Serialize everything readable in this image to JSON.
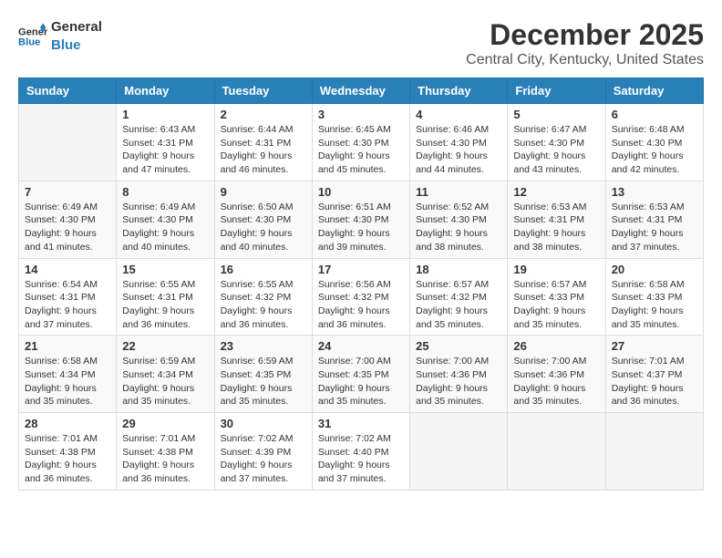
{
  "header": {
    "logo_line1": "General",
    "logo_line2": "Blue",
    "month_title": "December 2025",
    "location": "Central City, Kentucky, United States"
  },
  "weekdays": [
    "Sunday",
    "Monday",
    "Tuesday",
    "Wednesday",
    "Thursday",
    "Friday",
    "Saturday"
  ],
  "weeks": [
    [
      {
        "day": "",
        "info": ""
      },
      {
        "day": "1",
        "info": "Sunrise: 6:43 AM\nSunset: 4:31 PM\nDaylight: 9 hours\nand 47 minutes."
      },
      {
        "day": "2",
        "info": "Sunrise: 6:44 AM\nSunset: 4:31 PM\nDaylight: 9 hours\nand 46 minutes."
      },
      {
        "day": "3",
        "info": "Sunrise: 6:45 AM\nSunset: 4:30 PM\nDaylight: 9 hours\nand 45 minutes."
      },
      {
        "day": "4",
        "info": "Sunrise: 6:46 AM\nSunset: 4:30 PM\nDaylight: 9 hours\nand 44 minutes."
      },
      {
        "day": "5",
        "info": "Sunrise: 6:47 AM\nSunset: 4:30 PM\nDaylight: 9 hours\nand 43 minutes."
      },
      {
        "day": "6",
        "info": "Sunrise: 6:48 AM\nSunset: 4:30 PM\nDaylight: 9 hours\nand 42 minutes."
      }
    ],
    [
      {
        "day": "7",
        "info": "Sunrise: 6:49 AM\nSunset: 4:30 PM\nDaylight: 9 hours\nand 41 minutes."
      },
      {
        "day": "8",
        "info": "Sunrise: 6:49 AM\nSunset: 4:30 PM\nDaylight: 9 hours\nand 40 minutes."
      },
      {
        "day": "9",
        "info": "Sunrise: 6:50 AM\nSunset: 4:30 PM\nDaylight: 9 hours\nand 40 minutes."
      },
      {
        "day": "10",
        "info": "Sunrise: 6:51 AM\nSunset: 4:30 PM\nDaylight: 9 hours\nand 39 minutes."
      },
      {
        "day": "11",
        "info": "Sunrise: 6:52 AM\nSunset: 4:30 PM\nDaylight: 9 hours\nand 38 minutes."
      },
      {
        "day": "12",
        "info": "Sunrise: 6:53 AM\nSunset: 4:31 PM\nDaylight: 9 hours\nand 38 minutes."
      },
      {
        "day": "13",
        "info": "Sunrise: 6:53 AM\nSunset: 4:31 PM\nDaylight: 9 hours\nand 37 minutes."
      }
    ],
    [
      {
        "day": "14",
        "info": "Sunrise: 6:54 AM\nSunset: 4:31 PM\nDaylight: 9 hours\nand 37 minutes."
      },
      {
        "day": "15",
        "info": "Sunrise: 6:55 AM\nSunset: 4:31 PM\nDaylight: 9 hours\nand 36 minutes."
      },
      {
        "day": "16",
        "info": "Sunrise: 6:55 AM\nSunset: 4:32 PM\nDaylight: 9 hours\nand 36 minutes."
      },
      {
        "day": "17",
        "info": "Sunrise: 6:56 AM\nSunset: 4:32 PM\nDaylight: 9 hours\nand 36 minutes."
      },
      {
        "day": "18",
        "info": "Sunrise: 6:57 AM\nSunset: 4:32 PM\nDaylight: 9 hours\nand 35 minutes."
      },
      {
        "day": "19",
        "info": "Sunrise: 6:57 AM\nSunset: 4:33 PM\nDaylight: 9 hours\nand 35 minutes."
      },
      {
        "day": "20",
        "info": "Sunrise: 6:58 AM\nSunset: 4:33 PM\nDaylight: 9 hours\nand 35 minutes."
      }
    ],
    [
      {
        "day": "21",
        "info": "Sunrise: 6:58 AM\nSunset: 4:34 PM\nDaylight: 9 hours\nand 35 minutes."
      },
      {
        "day": "22",
        "info": "Sunrise: 6:59 AM\nSunset: 4:34 PM\nDaylight: 9 hours\nand 35 minutes."
      },
      {
        "day": "23",
        "info": "Sunrise: 6:59 AM\nSunset: 4:35 PM\nDaylight: 9 hours\nand 35 minutes."
      },
      {
        "day": "24",
        "info": "Sunrise: 7:00 AM\nSunset: 4:35 PM\nDaylight: 9 hours\nand 35 minutes."
      },
      {
        "day": "25",
        "info": "Sunrise: 7:00 AM\nSunset: 4:36 PM\nDaylight: 9 hours\nand 35 minutes."
      },
      {
        "day": "26",
        "info": "Sunrise: 7:00 AM\nSunset: 4:36 PM\nDaylight: 9 hours\nand 35 minutes."
      },
      {
        "day": "27",
        "info": "Sunrise: 7:01 AM\nSunset: 4:37 PM\nDaylight: 9 hours\nand 36 minutes."
      }
    ],
    [
      {
        "day": "28",
        "info": "Sunrise: 7:01 AM\nSunset: 4:38 PM\nDaylight: 9 hours\nand 36 minutes."
      },
      {
        "day": "29",
        "info": "Sunrise: 7:01 AM\nSunset: 4:38 PM\nDaylight: 9 hours\nand 36 minutes."
      },
      {
        "day": "30",
        "info": "Sunrise: 7:02 AM\nSunset: 4:39 PM\nDaylight: 9 hours\nand 37 minutes."
      },
      {
        "day": "31",
        "info": "Sunrise: 7:02 AM\nSunset: 4:40 PM\nDaylight: 9 hours\nand 37 minutes."
      },
      {
        "day": "",
        "info": ""
      },
      {
        "day": "",
        "info": ""
      },
      {
        "day": "",
        "info": ""
      }
    ]
  ]
}
